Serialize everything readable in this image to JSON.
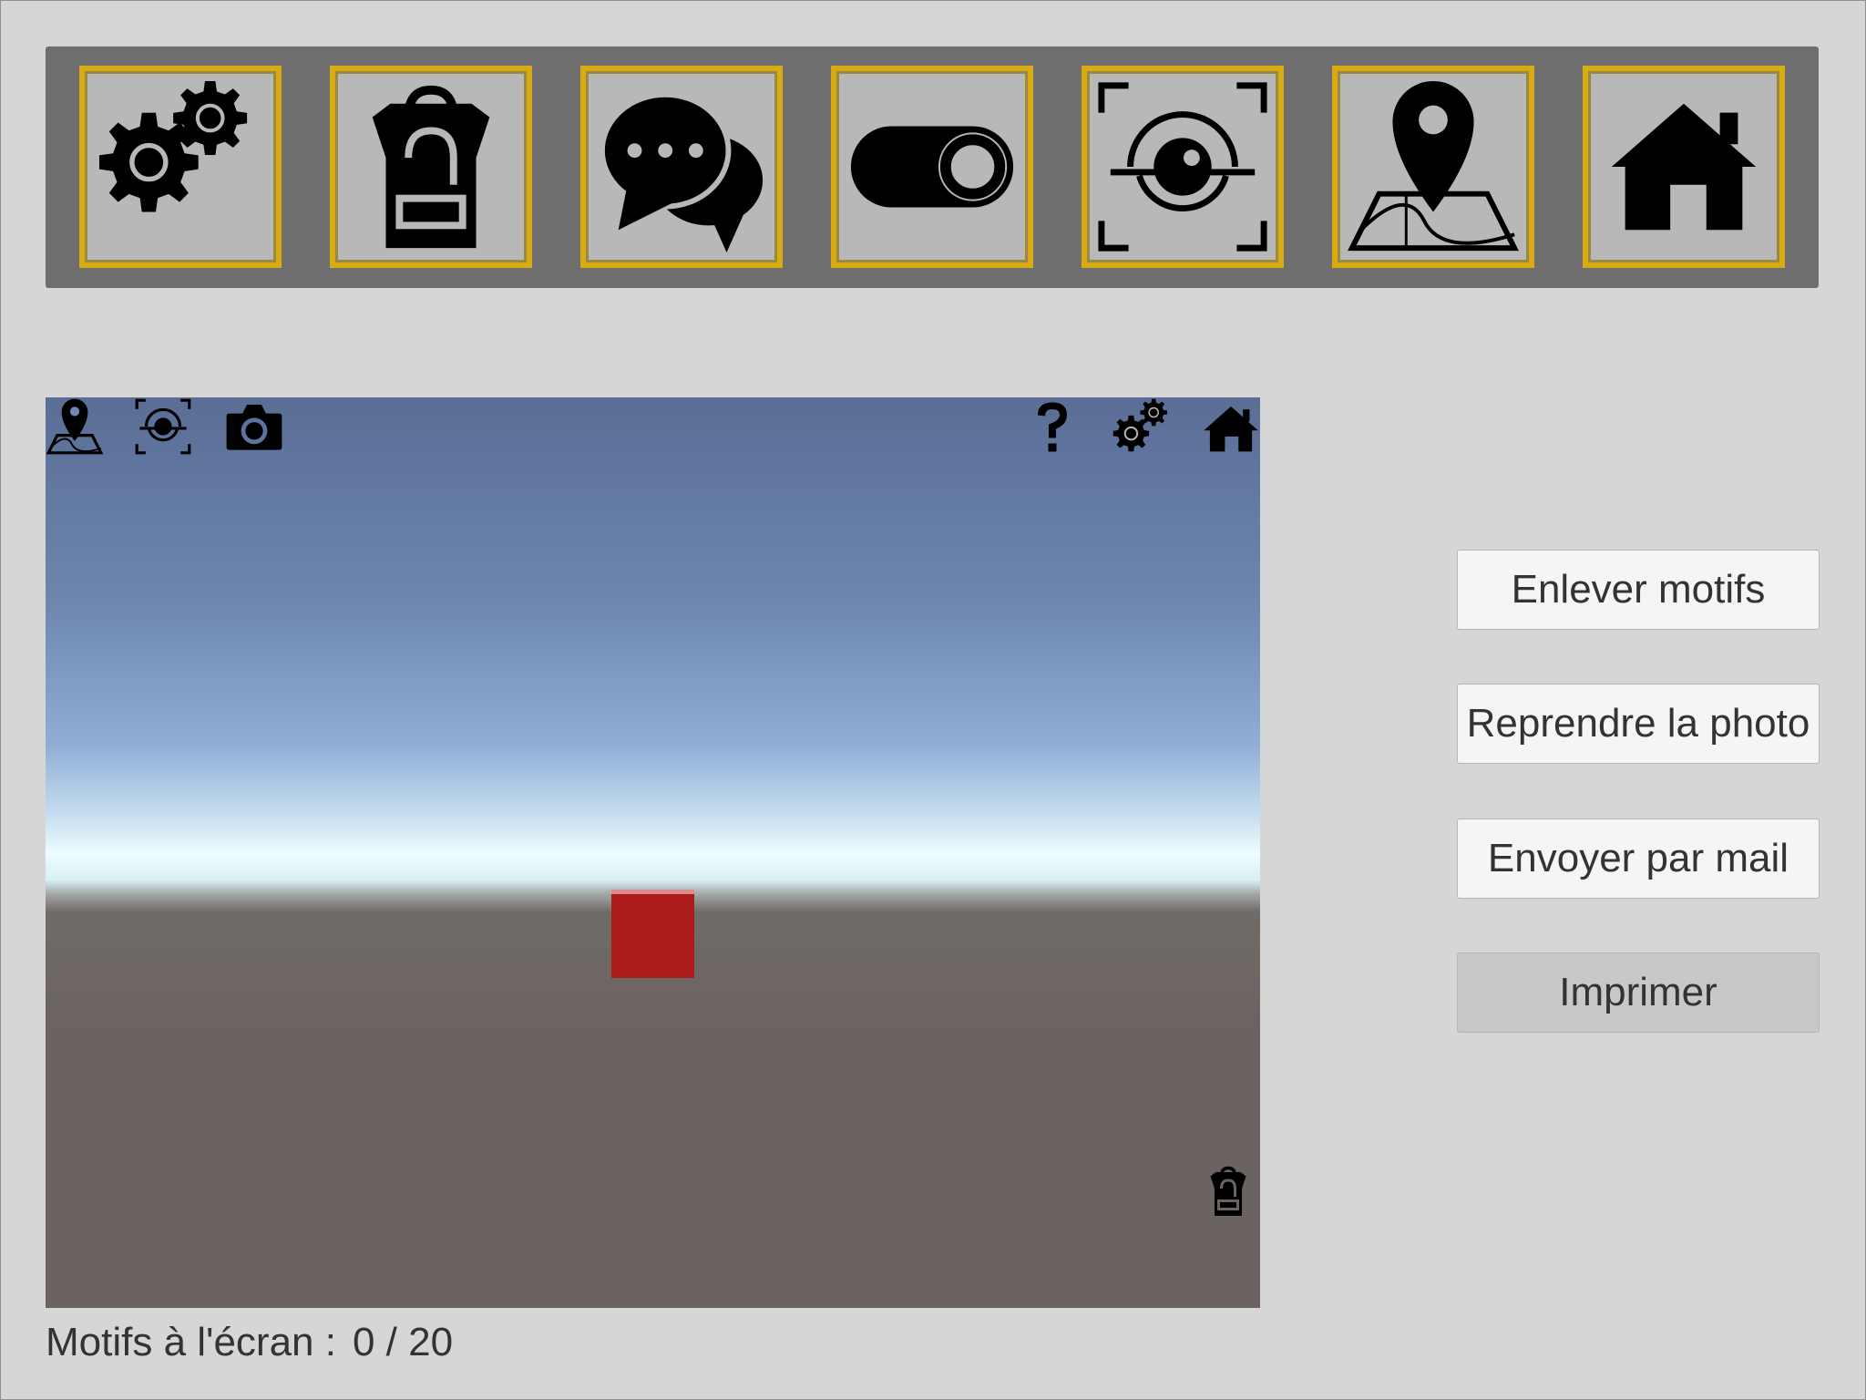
{
  "toolbar": {
    "buttons": [
      {
        "icon": "gears-icon",
        "name": "settings"
      },
      {
        "icon": "backpack-icon",
        "name": "inventory"
      },
      {
        "icon": "chat-icon",
        "name": "dialogue"
      },
      {
        "icon": "toggle-icon",
        "name": "toggle"
      },
      {
        "icon": "eye-scan-icon",
        "name": "scan"
      },
      {
        "icon": "map-pin-icon",
        "name": "map"
      },
      {
        "icon": "home-icon",
        "name": "home"
      }
    ],
    "accent_color": "#d9aa12"
  },
  "viewport": {
    "top_left_icons": [
      "map-pin-icon",
      "eye-scan-icon",
      "camera-icon"
    ],
    "top_right_icons": [
      "help-icon",
      "gears-icon",
      "home-icon"
    ],
    "bottom_right_icon": "backpack-icon",
    "cube_color": "#ab1b1b"
  },
  "side_buttons": {
    "remove_patterns": "Enlever motifs",
    "retake_photo": "Reprendre la photo",
    "send_mail": "Envoyer par mail",
    "print": "Imprimer"
  },
  "counter": {
    "label": "Motifs à l'écran :",
    "value": "0 / 20"
  }
}
